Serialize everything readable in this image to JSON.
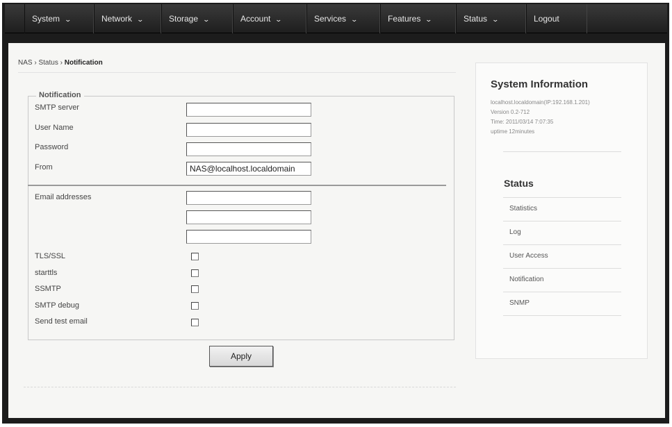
{
  "nav": [
    {
      "label": "System",
      "chevron": true
    },
    {
      "label": "Network",
      "chevron": true
    },
    {
      "label": "Storage",
      "chevron": true
    },
    {
      "label": "Account",
      "chevron": true
    },
    {
      "label": "Services",
      "chevron": true
    },
    {
      "label": "Features",
      "chevron": true
    },
    {
      "label": "Status",
      "chevron": true
    },
    {
      "label": "Logout",
      "chevron": false
    }
  ],
  "breadcrumb": {
    "root": "NAS",
    "sep": "›",
    "parent": "Status",
    "current": "Notification"
  },
  "form": {
    "legend": "Notification",
    "smtp_server_label": "SMTP server",
    "smtp_server_value": "",
    "username_label": "User Name",
    "username_value": "",
    "password_label": "Password",
    "password_value": "",
    "from_label": "From",
    "from_value": "NAS@localhost.localdomain",
    "email_label": "Email addresses",
    "email_values": [
      "",
      "",
      ""
    ],
    "checkboxes": [
      {
        "label": "TLS/SSL",
        "checked": false
      },
      {
        "label": "starttls",
        "checked": false
      },
      {
        "label": "SSMTP",
        "checked": false
      },
      {
        "label": "SMTP debug",
        "checked": false
      },
      {
        "label": "Send test email",
        "checked": false
      }
    ],
    "apply_label": "Apply"
  },
  "sidebar": {
    "title": "System Information",
    "info": [
      "localhost.localdomain(IP:192.168.1.201)",
      "Version 0.2-712",
      "Time: 2011/03/14 7:07:35",
      "uptime 12minutes"
    ],
    "status_title": "Status",
    "links": [
      "Statistics",
      "Log",
      "User Access",
      "Notification",
      "SNMP"
    ]
  }
}
